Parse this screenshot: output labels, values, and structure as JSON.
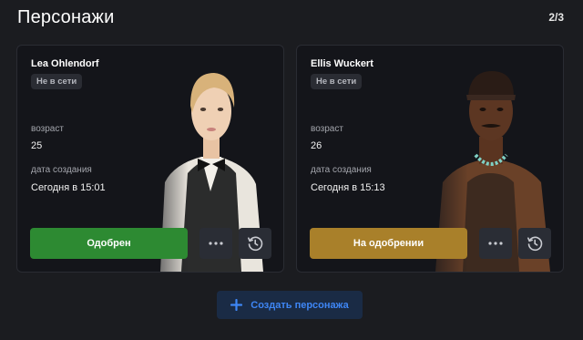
{
  "header": {
    "title": "Персонажи",
    "counter": "2/3"
  },
  "characters": [
    {
      "name": "Lea Ohlendorf",
      "online_status": "Не в сети",
      "age_label": "возраст",
      "age": "25",
      "created_label": "дата создания",
      "created": "Сегодня в 15:01",
      "status": "Одобрен",
      "status_color": "#2d8a32",
      "more_icon": "more-dots-icon",
      "history_icon": "history-icon"
    },
    {
      "name": "Ellis Wuckert",
      "online_status": "Не в сети",
      "age_label": "возраст",
      "age": "26",
      "created_label": "дата создания",
      "created": "Сегодня в 15:13",
      "status": "На одобрении",
      "status_color": "#a9802a",
      "more_icon": "more-dots-icon",
      "history_icon": "history-icon"
    }
  ],
  "create_button": {
    "label": "Создать персонажа",
    "icon": "plus-icon"
  }
}
